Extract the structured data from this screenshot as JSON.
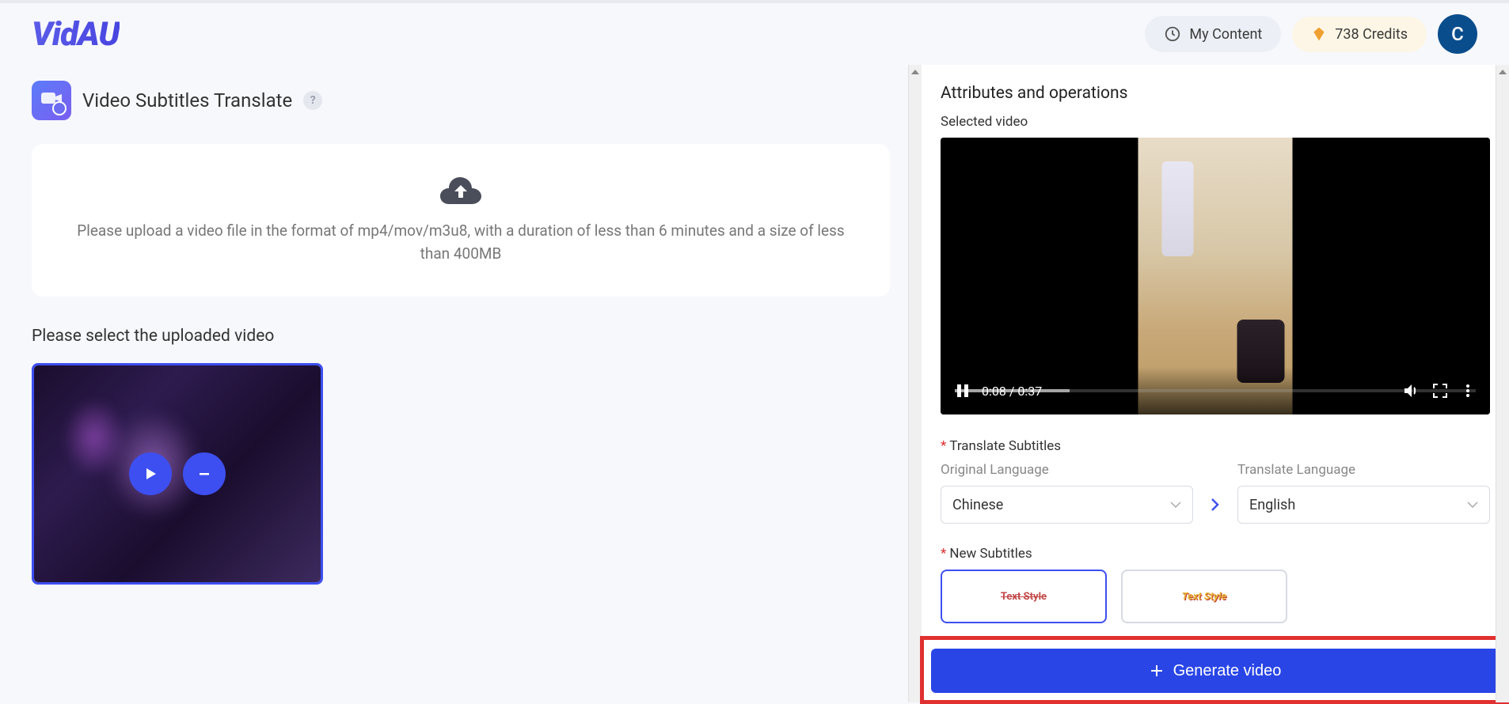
{
  "logo": "VidAU",
  "header": {
    "my_content": "My Content",
    "credits_count": "738 Credits",
    "avatar_letter": "C"
  },
  "page": {
    "title": "Video Subtitles Translate",
    "upload_hint": "Please upload a video file in the format of mp4/mov/m3u8, with a duration of less than 6 minutes and a size of less than 400MB",
    "select_label": "Please select the uploaded video"
  },
  "right": {
    "attributes_title": "Attributes and operations",
    "selected_video_label": "Selected video",
    "video_time": "0:08 / 0:37",
    "translate_subtitles_label": "Translate Subtitles",
    "original_language_label": "Original Language",
    "translate_language_label": "Translate Language",
    "original_language_value": "Chinese",
    "translate_language_value": "English",
    "new_subtitles_label": "New Subtitles",
    "style_text_1": "Text Style",
    "style_text_2": "Text Style",
    "generate_button": "Generate video"
  }
}
